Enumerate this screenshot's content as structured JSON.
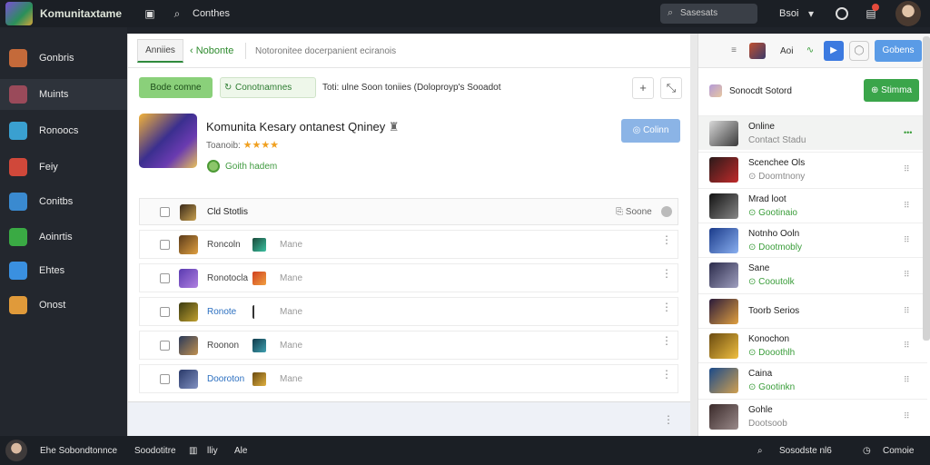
{
  "topbar": {
    "brand": "Komunitaxtame",
    "menu_label": "Conthes",
    "search_placeholder": "Sasesats",
    "user_label": "Bsoi",
    "notif_count": "2"
  },
  "sidebar": {
    "items": [
      {
        "label": "Gonbris",
        "icon": "gem-icon",
        "color": "#c46a3a",
        "suffix": "🗲"
      },
      {
        "label": "Muints",
        "icon": "fighter-icon",
        "color": "#9a4a5a"
      },
      {
        "label": "Ronoocs",
        "icon": "chat-icon",
        "color": "#3aa0d0"
      },
      {
        "label": "Feiy",
        "icon": "controller-icon",
        "color": "#d0483a"
      },
      {
        "label": "Conitbs",
        "icon": "gamepad-icon",
        "color": "#3a8ad0"
      },
      {
        "label": "Aoinrtis",
        "icon": "check-icon",
        "color": "#3aaa44"
      },
      {
        "label": "Ehtes",
        "icon": "gear-icon",
        "color": "#3a90e0"
      },
      {
        "label": "Onost",
        "icon": "hand-icon",
        "color": "#e09a3a"
      }
    ]
  },
  "main": {
    "tab_active": "Anniies",
    "tab_link": "Nobonte",
    "tab_desc": "Notoronitee docerpanient eciranois",
    "btn_primary": "Bode comne",
    "btn_secondary": "Conotnamnes",
    "filter_text": "Toti: ulne Soon toniies (Doloproyp's Sooadot",
    "game_title": "Komunita Kesary ontanest Qniney",
    "rating_label": "Toanoib:",
    "stars": "★★★★",
    "status_text": "Goith hadem",
    "btn_join": "Colinn",
    "list_header": {
      "label": "Cld Stotlis",
      "sort_label": "Soone"
    },
    "rows": [
      {
        "name": "Roncoln",
        "mode": "Mane",
        "name_color": "#444"
      },
      {
        "name": "Ronotocla",
        "mode": "Mane",
        "name_color": "#444"
      },
      {
        "name": "Ronote",
        "mode": "Mane",
        "name_color": "#2b6fc0"
      },
      {
        "name": "Roonon",
        "mode": "Mane",
        "name_color": "#444"
      },
      {
        "name": "Dooroton",
        "mode": "Mane",
        "name_color": "#2b6fc0"
      }
    ]
  },
  "rpanel": {
    "top_label": "Aoi",
    "top_btn": "Gobens",
    "head_label": "Sonocdt Sotord",
    "head_btn": "Stimma",
    "friends": [
      {
        "name": "Online",
        "status": "Contact Stadu",
        "status_color": "gray",
        "dots": "•••",
        "active": true
      },
      {
        "name": "Scenchee Ols",
        "status": "Doomtnony",
        "status_color": "gray",
        "dots": "⠿"
      },
      {
        "name": "Mrad loot",
        "status": "Gootinaio",
        "status_color": "green",
        "dots": "⠿"
      },
      {
        "name": "Notnho Ooln",
        "status": "Dootmobly",
        "status_color": "green",
        "dots": "⠿"
      },
      {
        "name": "Sane",
        "status": "Cooutolk",
        "status_color": "green",
        "dots": "⠿"
      },
      {
        "name": "Toorb Serios",
        "status": "",
        "status_color": "gray",
        "dots": "⠿"
      },
      {
        "name": "Konochon",
        "status": "Dooothlh",
        "status_color": "green",
        "dots": "⠿"
      },
      {
        "name": "Caina",
        "status": "Gootinkn",
        "status_color": "green",
        "dots": "⠿"
      },
      {
        "name": "Gohle",
        "status": "Dootsoob",
        "status_color": "gray",
        "dots": "⠿"
      }
    ]
  },
  "bottombar": {
    "name": "Ehe Sobondtonnce",
    "item1": "Soodotitre",
    "item2": "lliy",
    "item3": "Ale",
    "right1": "Sosodste nl6",
    "right2": "Comoie"
  }
}
